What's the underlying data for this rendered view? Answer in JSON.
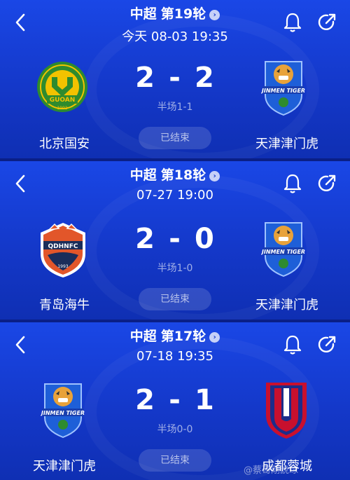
{
  "matches": [
    {
      "league": "中超",
      "round": "第19轮",
      "datetime": "今天 08-03 19:35",
      "home_score": "2",
      "away_score": "2",
      "score_sep": "-",
      "halftime": "半场1-1",
      "status": "已结束",
      "home_team": "北京国安",
      "away_team": "天津津门虎"
    },
    {
      "league": "中超",
      "round": "第18轮",
      "datetime": "07-27 19:00",
      "home_score": "2",
      "away_score": "0",
      "score_sep": "-",
      "halftime": "半场1-0",
      "status": "已结束",
      "home_team": "青岛海牛",
      "away_team": "天津津门虎"
    },
    {
      "league": "中超",
      "round": "第17轮",
      "datetime": "07-18 19:35",
      "home_score": "2",
      "away_score": "1",
      "score_sep": "-",
      "halftime": "半场0-0",
      "status": "已结束",
      "home_team": "天津津门虎",
      "away_team": "成都蓉城"
    }
  ],
  "logos": {
    "guoan_text": "GUOAN",
    "guoan_year": "1992",
    "qdhn_text": "QDHNFC",
    "qdhn_year": "1993",
    "tiger_text": "JINMEN TIGER"
  },
  "watermark": "@蔡哥剛說球",
  "colors": {
    "background": "#1438c9",
    "guoan_green": "#2e8b2e",
    "guoan_yellow": "#f2c200",
    "qdhn_orange": "#e2562a",
    "chengdu_red": "#c8102e"
  }
}
